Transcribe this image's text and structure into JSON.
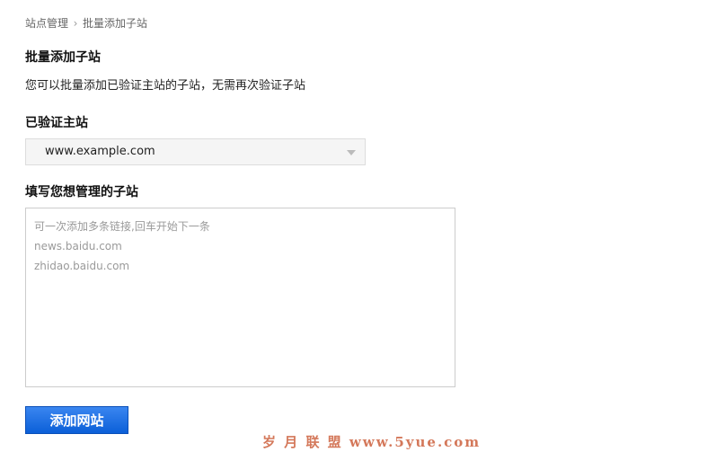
{
  "breadcrumb": {
    "items": [
      "站点管理",
      "批量添加子站"
    ],
    "separator_icon": "chevron-right-icon"
  },
  "header": {
    "title": "批量添加子站",
    "description": "您可以批量添加已验证主站的子站，无需再次验证子站"
  },
  "main_site": {
    "label": "已验证主站",
    "selected_value": "www.example.com",
    "dropdown_icon": "caret-down-icon"
  },
  "subsites": {
    "label": "填写您想管理的子站",
    "placeholder_lines": [
      "可一次添加多条链接,回车开始下一条",
      "news.baidu.com",
      "zhidao.baidu.com"
    ]
  },
  "actions": {
    "submit_label": "添加网站"
  },
  "watermark": {
    "text": "岁 月 联 盟  www.5yue.com"
  },
  "colors": {
    "button_bg": "#1a6fe3",
    "watermark": "#d4785a",
    "select_bg": "#f5f5f5"
  }
}
